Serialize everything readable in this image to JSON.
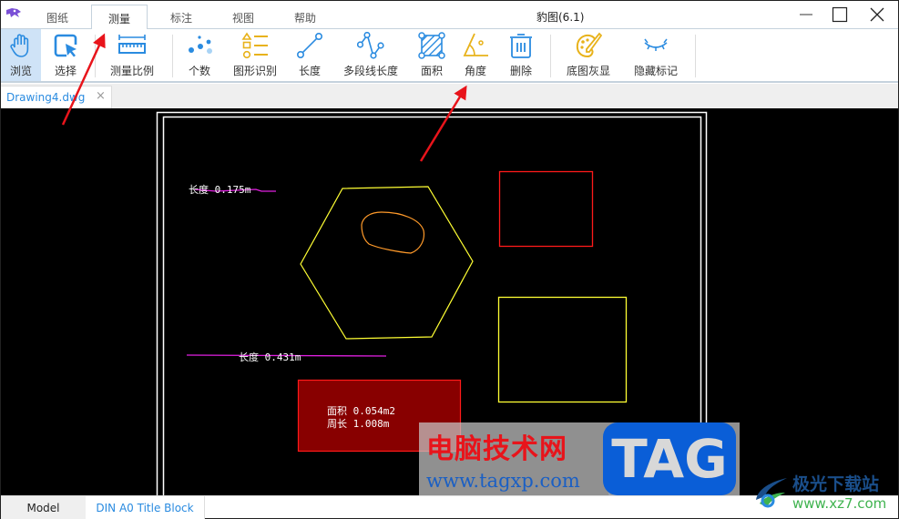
{
  "window": {
    "title": "豹图(6.1)",
    "controls": {
      "minimize": "minimize",
      "maximize": "maximize",
      "close": "close"
    }
  },
  "menu_tabs": [
    {
      "label": "图纸",
      "active": false
    },
    {
      "label": "测量",
      "active": true
    },
    {
      "label": "标注",
      "active": false
    },
    {
      "label": "视图",
      "active": false
    },
    {
      "label": "帮助",
      "active": false
    }
  ],
  "ribbon": {
    "browse": "浏览",
    "select": "选择",
    "scale": "测量比例",
    "count": "个数",
    "shape_recognition": "图形识别",
    "length": "长度",
    "polyline_length": "多段线长度",
    "area": "面积",
    "angle": "角度",
    "delete": "删除",
    "gray_background": "底图灰显",
    "hide_marks": "隐藏标记"
  },
  "document_tab": {
    "label": "Drawing4.dwg",
    "close": "×"
  },
  "drawing": {
    "annotations": {
      "length1": "长度 0.175m",
      "length2": "长度 0.431m",
      "area": "面积 0.054m2",
      "perimeter": "周长 1.008m"
    },
    "colors": {
      "yellow": "#ffff33",
      "red": "#ff1a1a",
      "orange": "#ff9a2a",
      "magenta": "#e020e0",
      "area_fill": "#880000"
    }
  },
  "layout_tabs": [
    {
      "label": "Model",
      "active": false
    },
    {
      "label": "DIN A0 Title Block",
      "active": true
    }
  ],
  "watermarks": {
    "site_cn": "电脑技术网",
    "site_url": "www.tagxp.com",
    "tag": "TAG",
    "xz7_cn": "极光下载站",
    "xz7_url": "www.xz7.com"
  },
  "colors": {
    "accent": "#2a8be0",
    "icon_yellow": "#e8b21a",
    "selected_bg": "#cfe3f7"
  }
}
